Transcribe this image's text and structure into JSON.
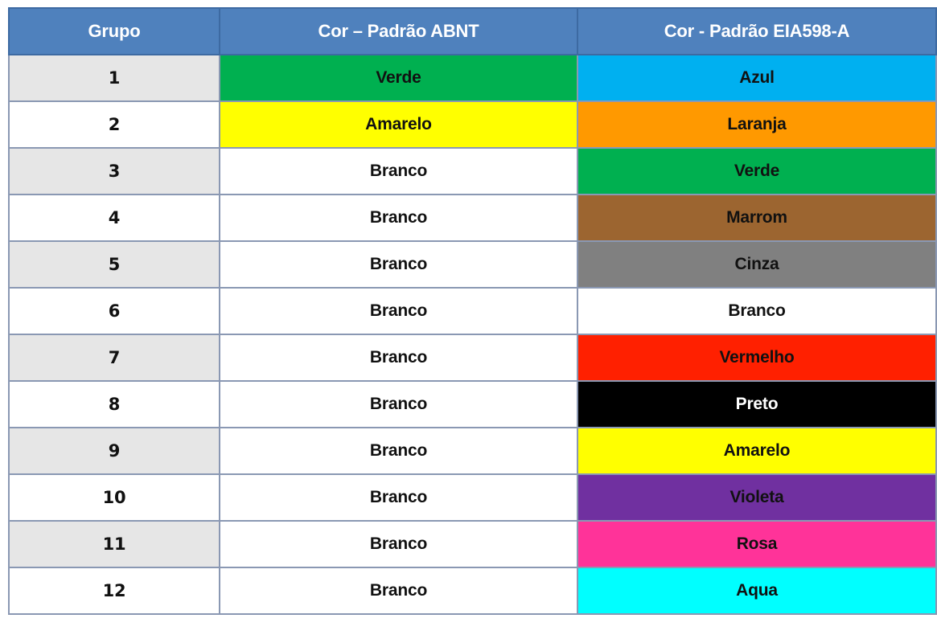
{
  "table": {
    "headers": {
      "grupo": "Grupo",
      "abnt": "Cor – Padrão ABNT",
      "eia": "Cor - Padrão EIA598-A"
    },
    "rows": [
      {
        "grupo": "1",
        "abnt": {
          "label": "Verde",
          "bg": "#00b050",
          "fg": "#111111"
        },
        "eia": {
          "label": "Azul",
          "bg": "#00b0f0",
          "fg": "#111111"
        }
      },
      {
        "grupo": "2",
        "abnt": {
          "label": "Amarelo",
          "bg": "#ffff00",
          "fg": "#111111"
        },
        "eia": {
          "label": "Laranja",
          "bg": "#ff9900",
          "fg": "#111111"
        }
      },
      {
        "grupo": "3",
        "abnt": {
          "label": "Branco",
          "bg": "#ffffff",
          "fg": "#111111"
        },
        "eia": {
          "label": "Verde",
          "bg": "#00b050",
          "fg": "#111111"
        }
      },
      {
        "grupo": "4",
        "abnt": {
          "label": "Branco",
          "bg": "#ffffff",
          "fg": "#111111"
        },
        "eia": {
          "label": "Marrom",
          "bg": "#9c6530",
          "fg": "#111111"
        }
      },
      {
        "grupo": "5",
        "abnt": {
          "label": "Branco",
          "bg": "#ffffff",
          "fg": "#111111"
        },
        "eia": {
          "label": "Cinza",
          "bg": "#808080",
          "fg": "#111111"
        }
      },
      {
        "grupo": "6",
        "abnt": {
          "label": "Branco",
          "bg": "#ffffff",
          "fg": "#111111"
        },
        "eia": {
          "label": "Branco",
          "bg": "#ffffff",
          "fg": "#111111"
        }
      },
      {
        "grupo": "7",
        "abnt": {
          "label": "Branco",
          "bg": "#ffffff",
          "fg": "#111111"
        },
        "eia": {
          "label": "Vermelho",
          "bg": "#ff2000",
          "fg": "#111111"
        }
      },
      {
        "grupo": "8",
        "abnt": {
          "label": "Branco",
          "bg": "#ffffff",
          "fg": "#111111"
        },
        "eia": {
          "label": "Preto",
          "bg": "#000000",
          "fg": "#ffffff"
        }
      },
      {
        "grupo": "9",
        "abnt": {
          "label": "Branco",
          "bg": "#ffffff",
          "fg": "#111111"
        },
        "eia": {
          "label": "Amarelo",
          "bg": "#ffff00",
          "fg": "#111111"
        }
      },
      {
        "grupo": "10",
        "abnt": {
          "label": "Branco",
          "bg": "#ffffff",
          "fg": "#111111"
        },
        "eia": {
          "label": "Violeta",
          "bg": "#7030a0",
          "fg": "#111111"
        }
      },
      {
        "grupo": "11",
        "abnt": {
          "label": "Branco",
          "bg": "#ffffff",
          "fg": "#111111"
        },
        "eia": {
          "label": "Rosa",
          "bg": "#ff3399",
          "fg": "#111111"
        }
      },
      {
        "grupo": "12",
        "abnt": {
          "label": "Branco",
          "bg": "#ffffff",
          "fg": "#111111"
        },
        "eia": {
          "label": "Aqua",
          "bg": "#00ffff",
          "fg": "#111111"
        }
      }
    ]
  },
  "colors": {
    "header_bg": "#4f81bd",
    "header_text": "#ffffff",
    "grid_line": "#8a98b3",
    "grupo_alt_bg": "#e6e6e6"
  }
}
